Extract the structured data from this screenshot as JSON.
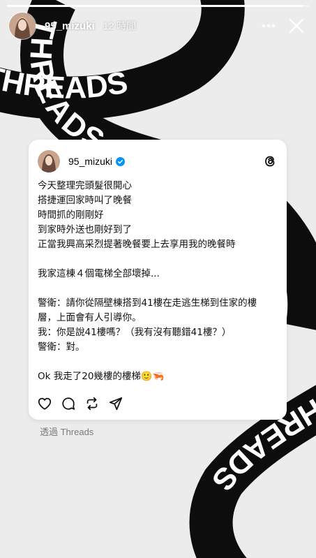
{
  "story": {
    "username": "95_mizuki",
    "time": "12 時間",
    "progress": 0.98,
    "via": "透過 Threads"
  },
  "background": {
    "pattern_text": "THREADS",
    "band_color": "#0d0d0d",
    "text_color": "#ffffff",
    "page_color": "#ececec"
  },
  "post": {
    "username": "95_mizuki",
    "verified": true,
    "lines": [
      "今天整理完頭髮很開心",
      "搭捷運回家時叫了晚餐",
      "時間抓的剛剛好",
      "到家時外送也剛好到了",
      "正當我興高采烈提著晚餐要上去享用我的晚餐時",
      "",
      "我家這棟４個電梯全部壞掉...",
      "",
      "警衛：請你從隔壁棟搭到41樓在走逃生梯到住家的樓",
      "層，上面會有人引導你。",
      "我：你是說41樓嗎？（我有沒有聽錯41樓？）",
      "警衛：對。",
      "",
      "Ok 我走了20幾樓的樓梯🙂🦐"
    ],
    "actions": [
      "heart-icon",
      "comment-icon",
      "repost-icon",
      "share-icon"
    ]
  },
  "icons": {
    "header": [
      "more-icon",
      "close-icon"
    ],
    "brand": "threads-logo-icon",
    "verified": "verified-badge-icon"
  }
}
